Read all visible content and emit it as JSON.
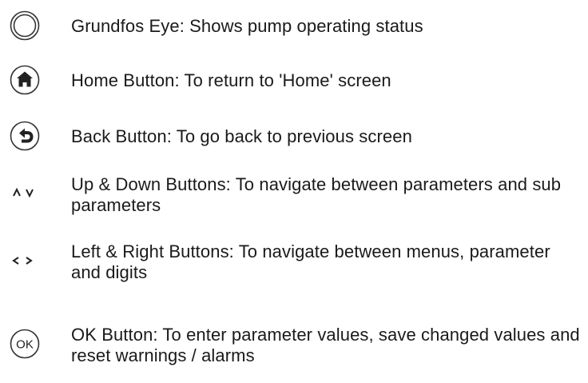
{
  "items": [
    {
      "icon": "grundfos-eye-icon",
      "text": "Grundfos Eye: Shows pump operating status"
    },
    {
      "icon": "home-icon",
      "text": "Home Button: To return to 'Home' screen"
    },
    {
      "icon": "back-arrow-icon",
      "text": "Back Button: To go back to previous screen"
    },
    {
      "icon": "up-down-icon",
      "glyph": "ʌ ʌ",
      "text": "Up & Down Buttons: To navigate between parameters and sub parameters"
    },
    {
      "icon": "left-right-icon",
      "glyph": "< >",
      "text": "Left & Right Buttons: To navigate between menus, parameter and digits"
    },
    {
      "icon": "ok-icon",
      "glyph": "OK",
      "text": "OK Button: To enter parameter values, save changed values and reset warnings / alarms"
    }
  ]
}
